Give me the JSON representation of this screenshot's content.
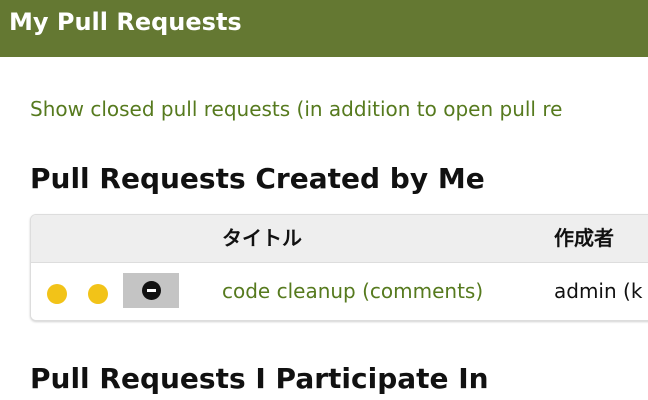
{
  "header": {
    "title": "My Pull Requests",
    "background_color": "#647832"
  },
  "show_closed_link": "Show closed pull requests (in addition to open pull re",
  "sections": {
    "created": {
      "heading": "Pull Requests Created by Me",
      "columns": {
        "title": "タイトル",
        "author": "作成者"
      },
      "rows": [
        {
          "status_icons": [
            "status-dot-yellow",
            "status-dot-yellow"
          ],
          "action_icon": "minus-circle-icon",
          "title": "code cleanup (comments)",
          "author": "admin (k"
        }
      ]
    },
    "participate": {
      "heading": "Pull Requests I Participate In"
    }
  },
  "colors": {
    "link": "#567a1e",
    "status_yellow": "#f2c318",
    "action_button_bg": "#c4c4c4"
  }
}
